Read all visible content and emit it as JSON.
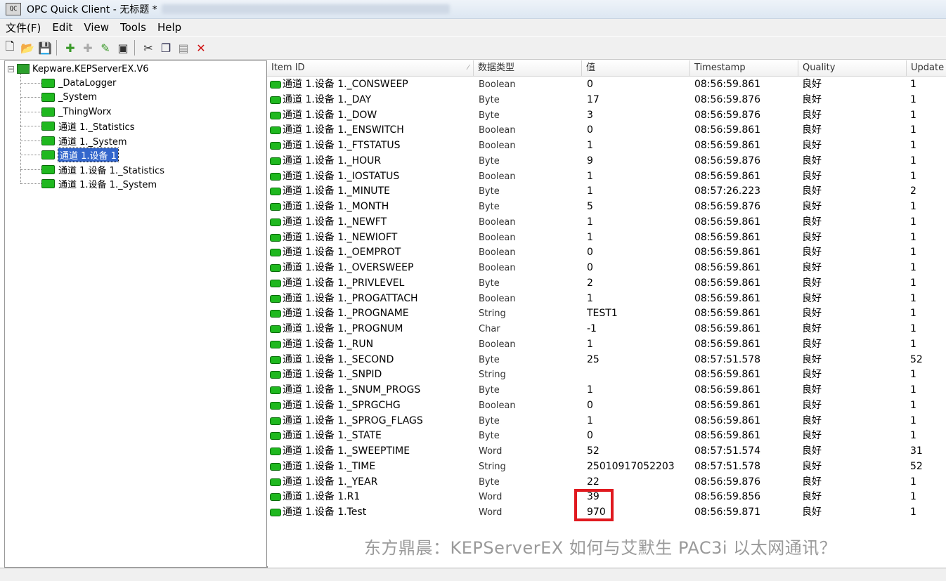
{
  "window": {
    "title": "OPC Quick Client - 无标题 *"
  },
  "menu": [
    "文件(F)",
    "Edit",
    "View",
    "Tools",
    "Help"
  ],
  "toolbar": [
    "new-file-icon",
    "open-folder-icon",
    "save-icon",
    "new-server-icon",
    "new-group-icon",
    "new-item-icon",
    "properties-icon",
    "cut-icon",
    "copy-icon",
    "paste-icon",
    "delete-icon"
  ],
  "tree": {
    "root": "Kepware.KEPServerEX.V6",
    "nodes": [
      "_DataLogger",
      "_System",
      "_ThingWorx",
      "通道 1._Statistics",
      "通道 1._System",
      "通道 1.设备 1",
      "通道 1.设备 1._Statistics",
      "通道 1.设备 1._System"
    ],
    "selected": "通道 1.设备 1"
  },
  "columns": [
    "Item ID",
    "数据类型",
    "值",
    "Timestamp",
    "Quality",
    "Update"
  ],
  "rows": [
    {
      "id": "通道 1.设备 1._CONSWEEP",
      "type": "Boolean",
      "value": "0",
      "ts": "08:56:59.861",
      "quality": "良好",
      "update": "1"
    },
    {
      "id": "通道 1.设备 1._DAY",
      "type": "Byte",
      "value": "17",
      "ts": "08:56:59.876",
      "quality": "良好",
      "update": "1"
    },
    {
      "id": "通道 1.设备 1._DOW",
      "type": "Byte",
      "value": "3",
      "ts": "08:56:59.876",
      "quality": "良好",
      "update": "1"
    },
    {
      "id": "通道 1.设备 1._ENSWITCH",
      "type": "Boolean",
      "value": "0",
      "ts": "08:56:59.861",
      "quality": "良好",
      "update": "1"
    },
    {
      "id": "通道 1.设备 1._FTSTATUS",
      "type": "Boolean",
      "value": "1",
      "ts": "08:56:59.861",
      "quality": "良好",
      "update": "1"
    },
    {
      "id": "通道 1.设备 1._HOUR",
      "type": "Byte",
      "value": "9",
      "ts": "08:56:59.876",
      "quality": "良好",
      "update": "1"
    },
    {
      "id": "通道 1.设备 1._IOSTATUS",
      "type": "Boolean",
      "value": "1",
      "ts": "08:56:59.861",
      "quality": "良好",
      "update": "1"
    },
    {
      "id": "通道 1.设备 1._MINUTE",
      "type": "Byte",
      "value": "1",
      "ts": "08:57:26.223",
      "quality": "良好",
      "update": "2"
    },
    {
      "id": "通道 1.设备 1._MONTH",
      "type": "Byte",
      "value": "5",
      "ts": "08:56:59.876",
      "quality": "良好",
      "update": "1"
    },
    {
      "id": "通道 1.设备 1._NEWFT",
      "type": "Boolean",
      "value": "1",
      "ts": "08:56:59.861",
      "quality": "良好",
      "update": "1"
    },
    {
      "id": "通道 1.设备 1._NEWIOFT",
      "type": "Boolean",
      "value": "1",
      "ts": "08:56:59.861",
      "quality": "良好",
      "update": "1"
    },
    {
      "id": "通道 1.设备 1._OEMPROT",
      "type": "Boolean",
      "value": "0",
      "ts": "08:56:59.861",
      "quality": "良好",
      "update": "1"
    },
    {
      "id": "通道 1.设备 1._OVERSWEEP",
      "type": "Boolean",
      "value": "0",
      "ts": "08:56:59.861",
      "quality": "良好",
      "update": "1"
    },
    {
      "id": "通道 1.设备 1._PRIVLEVEL",
      "type": "Byte",
      "value": "2",
      "ts": "08:56:59.861",
      "quality": "良好",
      "update": "1"
    },
    {
      "id": "通道 1.设备 1._PROGATTACH",
      "type": "Boolean",
      "value": "1",
      "ts": "08:56:59.861",
      "quality": "良好",
      "update": "1"
    },
    {
      "id": "通道 1.设备 1._PROGNAME",
      "type": "String",
      "value": "TEST1",
      "ts": "08:56:59.861",
      "quality": "良好",
      "update": "1"
    },
    {
      "id": "通道 1.设备 1._PROGNUM",
      "type": "Char",
      "value": "-1",
      "ts": "08:56:59.861",
      "quality": "良好",
      "update": "1"
    },
    {
      "id": "通道 1.设备 1._RUN",
      "type": "Boolean",
      "value": "1",
      "ts": "08:56:59.861",
      "quality": "良好",
      "update": "1"
    },
    {
      "id": "通道 1.设备 1._SECOND",
      "type": "Byte",
      "value": "25",
      "ts": "08:57:51.578",
      "quality": "良好",
      "update": "52"
    },
    {
      "id": "通道 1.设备 1._SNPID",
      "type": "String",
      "value": "",
      "ts": "08:56:59.861",
      "quality": "良好",
      "update": "1"
    },
    {
      "id": "通道 1.设备 1._SNUM_PROGS",
      "type": "Byte",
      "value": "1",
      "ts": "08:56:59.861",
      "quality": "良好",
      "update": "1"
    },
    {
      "id": "通道 1.设备 1._SPRGCHG",
      "type": "Boolean",
      "value": "0",
      "ts": "08:56:59.861",
      "quality": "良好",
      "update": "1"
    },
    {
      "id": "通道 1.设备 1._SPROG_FLAGS",
      "type": "Byte",
      "value": "1",
      "ts": "08:56:59.861",
      "quality": "良好",
      "update": "1"
    },
    {
      "id": "通道 1.设备 1._STATE",
      "type": "Byte",
      "value": "0",
      "ts": "08:56:59.861",
      "quality": "良好",
      "update": "1"
    },
    {
      "id": "通道 1.设备 1._SWEEPTIME",
      "type": "Word",
      "value": "52",
      "ts": "08:57:51.574",
      "quality": "良好",
      "update": "31"
    },
    {
      "id": "通道 1.设备 1._TIME",
      "type": "String",
      "value": "25010917052203",
      "ts": "08:57:51.578",
      "quality": "良好",
      "update": "52"
    },
    {
      "id": "通道 1.设备 1._YEAR",
      "type": "Byte",
      "value": "22",
      "ts": "08:56:59.876",
      "quality": "良好",
      "update": "1"
    },
    {
      "id": "通道 1.设备 1.R1",
      "type": "Word",
      "value": "39",
      "ts": "08:56:59.856",
      "quality": "良好",
      "update": "1"
    },
    {
      "id": "通道 1.设备 1.Test",
      "type": "Word",
      "value": "970",
      "ts": "08:56:59.871",
      "quality": "良好",
      "update": "1"
    }
  ],
  "watermark": "东方鼎晨：KEPServerEX 如何与艾默生 PAC3i 以太网通讯？",
  "colors": {
    "highlight": "#e0191f",
    "tag_icon": "#1fb81f",
    "selection": "#3366cc"
  }
}
